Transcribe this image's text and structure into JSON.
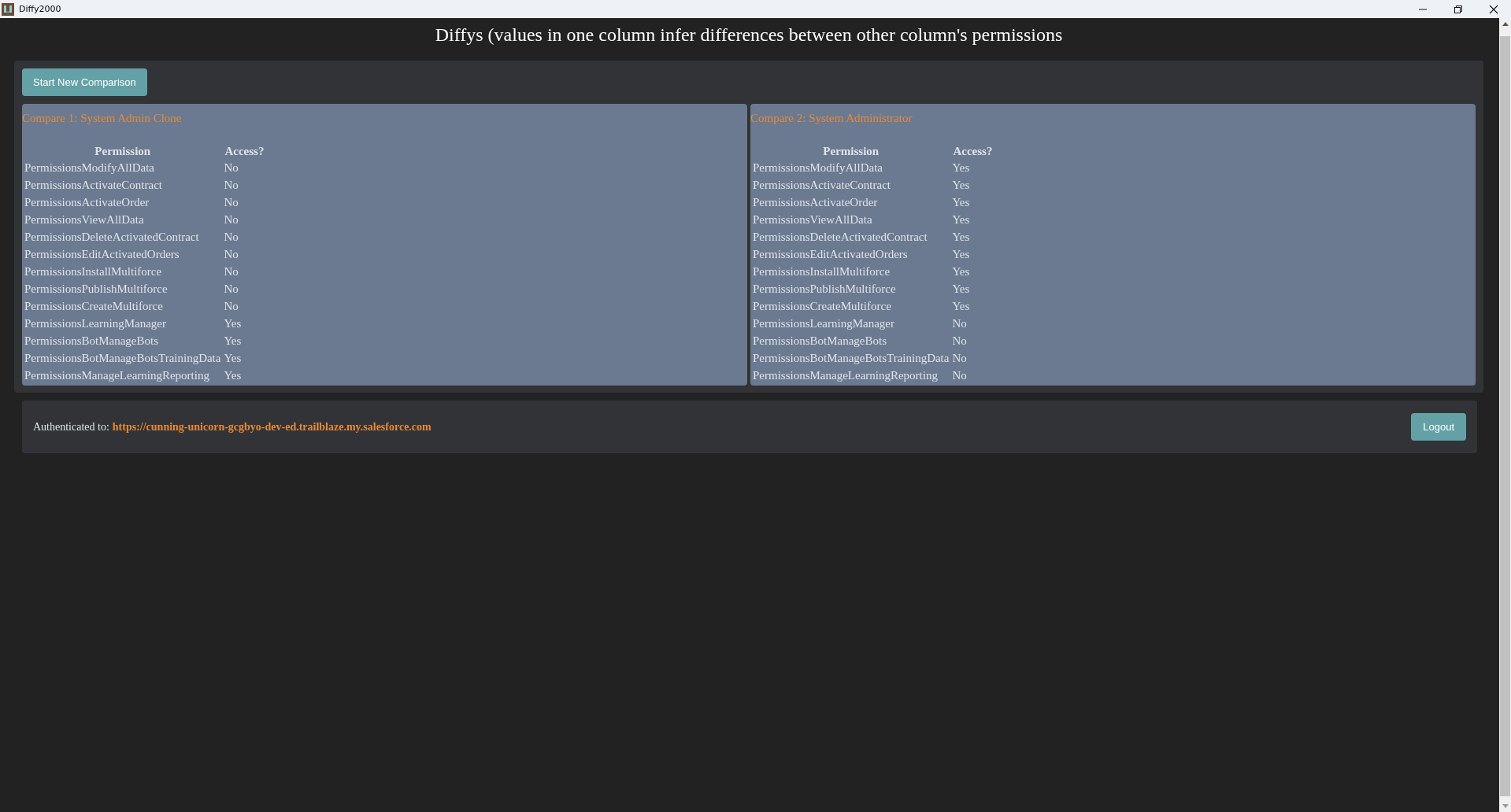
{
  "window": {
    "title": "Diffy2000"
  },
  "heading": "Diffys (values in one column infer differences between other column's permissions",
  "start_button": "Start New Comparison",
  "comparisons": [
    {
      "title": "Compare 1: System Admin Clone",
      "columns": [
        "Permission",
        "Access?"
      ],
      "rows": [
        [
          "PermissionsModifyAllData",
          "No"
        ],
        [
          "PermissionsActivateContract",
          "No"
        ],
        [
          "PermissionsActivateOrder",
          "No"
        ],
        [
          "PermissionsViewAllData",
          "No"
        ],
        [
          "PermissionsDeleteActivatedContract",
          "No"
        ],
        [
          "PermissionsEditActivatedOrders",
          "No"
        ],
        [
          "PermissionsInstallMultiforce",
          "No"
        ],
        [
          "PermissionsPublishMultiforce",
          "No"
        ],
        [
          "PermissionsCreateMultiforce",
          "No"
        ],
        [
          "PermissionsLearningManager",
          "Yes"
        ],
        [
          "PermissionsBotManageBots",
          "Yes"
        ],
        [
          "PermissionsBotManageBotsTrainingData",
          "Yes"
        ],
        [
          "PermissionsManageLearningReporting",
          "Yes"
        ]
      ]
    },
    {
      "title": "Compare 2: System Administrator",
      "columns": [
        "Permission",
        "Access?"
      ],
      "rows": [
        [
          "PermissionsModifyAllData",
          "Yes"
        ],
        [
          "PermissionsActivateContract",
          "Yes"
        ],
        [
          "PermissionsActivateOrder",
          "Yes"
        ],
        [
          "PermissionsViewAllData",
          "Yes"
        ],
        [
          "PermissionsDeleteActivatedContract",
          "Yes"
        ],
        [
          "PermissionsEditActivatedOrders",
          "Yes"
        ],
        [
          "PermissionsInstallMultiforce",
          "Yes"
        ],
        [
          "PermissionsPublishMultiforce",
          "Yes"
        ],
        [
          "PermissionsCreateMultiforce",
          "Yes"
        ],
        [
          "PermissionsLearningManager",
          "No"
        ],
        [
          "PermissionsBotManageBots",
          "No"
        ],
        [
          "PermissionsBotManageBotsTrainingData",
          "No"
        ],
        [
          "PermissionsManageLearningReporting",
          "No"
        ]
      ]
    }
  ],
  "footer": {
    "label": "Authenticated to:",
    "url": "https://cunning-unicorn-gcgbyo-dev-ed.trailblaze.my.salesforce.com",
    "logout_button": "Logout"
  }
}
